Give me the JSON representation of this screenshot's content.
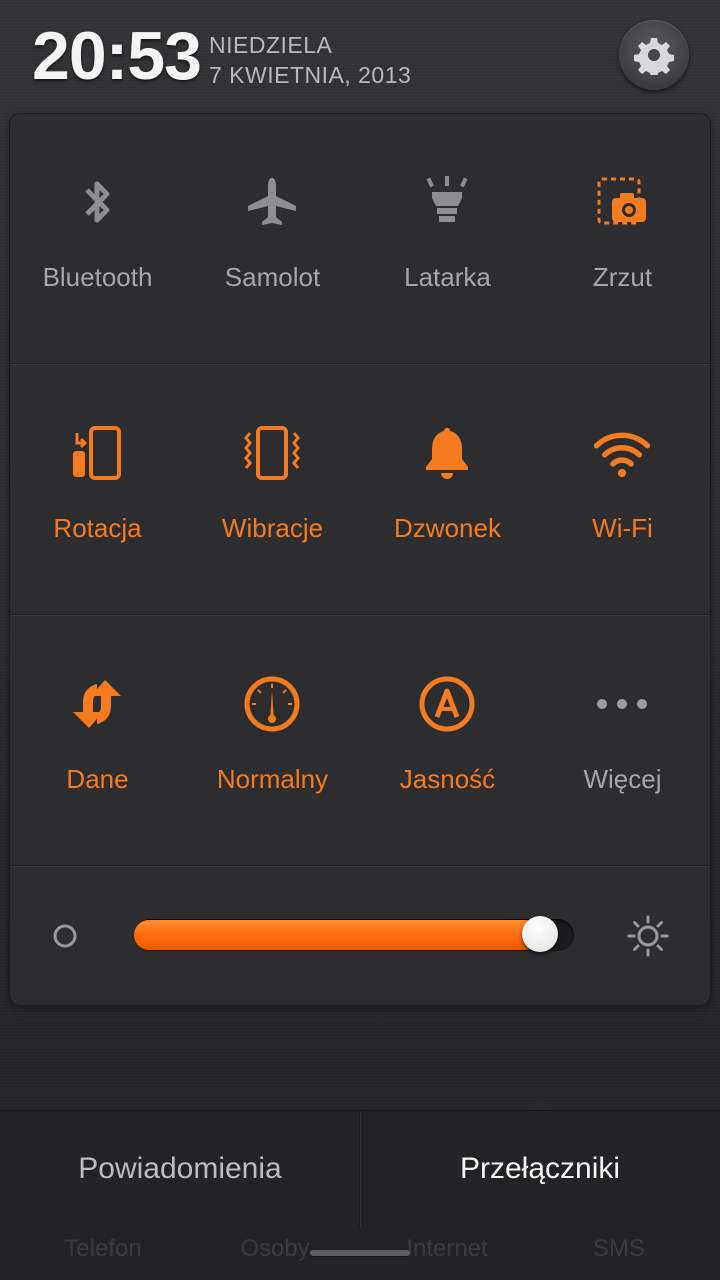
{
  "header": {
    "time": "20:53",
    "day": "NIEDZIELA",
    "date": "7 KWIETNIA, 2013"
  },
  "toggles": [
    [
      {
        "label": "Bluetooth",
        "icon": "bluetooth-icon",
        "active": false
      },
      {
        "label": "Samolot",
        "icon": "airplane-icon",
        "active": false
      },
      {
        "label": "Latarka",
        "icon": "flashlight-icon",
        "active": false
      },
      {
        "label": "Zrzut",
        "icon": "screenshot-icon",
        "active": true
      }
    ],
    [
      {
        "label": "Rotacja",
        "icon": "rotation-icon",
        "active": true
      },
      {
        "label": "Wibracje",
        "icon": "vibration-icon",
        "active": true
      },
      {
        "label": "Dzwonek",
        "icon": "bell-icon",
        "active": true
      },
      {
        "label": "Wi-Fi",
        "icon": "wifi-icon",
        "active": true
      }
    ],
    [
      {
        "label": "Dane",
        "icon": "data-sync-icon",
        "active": true
      },
      {
        "label": "Normalny",
        "icon": "gauge-icon",
        "active": true
      },
      {
        "label": "Jasność",
        "icon": "auto-brightness-icon",
        "active": true
      },
      {
        "label": "Więcej",
        "icon": "more-dots-icon",
        "active": false
      }
    ]
  ],
  "brightness": {
    "level": 0.96
  },
  "tabs": {
    "notifications": "Powiadomienia",
    "toggles": "Przełączniki",
    "active": "toggles"
  },
  "background_labels": [
    "Telefon",
    "Osoby",
    "Internet",
    "SMS"
  ],
  "colors": {
    "accent": "#f47b1f",
    "inactive": "#a7a7a9",
    "panel": "#2d2d30"
  }
}
